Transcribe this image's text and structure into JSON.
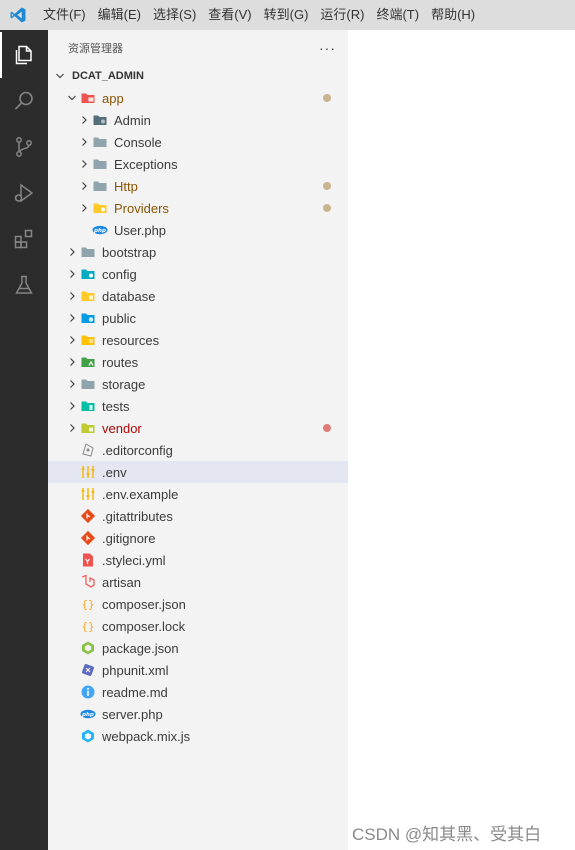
{
  "menu": [
    "文件(F)",
    "编辑(E)",
    "选择(S)",
    "查看(V)",
    "转到(G)",
    "运行(R)",
    "终端(T)",
    "帮助(H)"
  ],
  "activity": [
    "explorer-icon",
    "search-icon",
    "source-control-icon",
    "run-debug-icon",
    "extensions-icon",
    "testing-icon"
  ],
  "explorer": {
    "title": "资源管理器",
    "more": "···",
    "root": "DCAT_ADMIN",
    "items": [
      {
        "label": "app",
        "depth": 1,
        "expanded": true,
        "icon": "folder-app-icon",
        "status": "modified"
      },
      {
        "label": "Admin",
        "depth": 2,
        "expanded": false,
        "icon": "folder-admin-icon"
      },
      {
        "label": "Console",
        "depth": 2,
        "expanded": false,
        "icon": "folder-icon"
      },
      {
        "label": "Exceptions",
        "depth": 2,
        "expanded": false,
        "icon": "folder-icon"
      },
      {
        "label": "Http",
        "depth": 2,
        "expanded": false,
        "icon": "folder-icon",
        "status": "modified"
      },
      {
        "label": "Providers",
        "depth": 2,
        "expanded": false,
        "icon": "folder-providers-icon",
        "status": "modified"
      },
      {
        "label": "User.php",
        "depth": 2,
        "icon": "php-icon"
      },
      {
        "label": "bootstrap",
        "depth": 1,
        "expanded": false,
        "icon": "folder-icon"
      },
      {
        "label": "config",
        "depth": 1,
        "expanded": false,
        "icon": "folder-config-icon"
      },
      {
        "label": "database",
        "depth": 1,
        "expanded": false,
        "icon": "folder-database-icon"
      },
      {
        "label": "public",
        "depth": 1,
        "expanded": false,
        "icon": "folder-public-icon"
      },
      {
        "label": "resources",
        "depth": 1,
        "expanded": false,
        "icon": "folder-resources-icon"
      },
      {
        "label": "routes",
        "depth": 1,
        "expanded": false,
        "icon": "folder-routes-icon"
      },
      {
        "label": "storage",
        "depth": 1,
        "expanded": false,
        "icon": "folder-icon"
      },
      {
        "label": "tests",
        "depth": 1,
        "expanded": false,
        "icon": "folder-tests-icon"
      },
      {
        "label": "vendor",
        "depth": 1,
        "expanded": false,
        "icon": "folder-vendor-icon",
        "status": "error"
      },
      {
        "label": ".editorconfig",
        "depth": 1,
        "icon": "editorconfig-icon"
      },
      {
        "label": ".env",
        "depth": 1,
        "icon": "env-icon",
        "selected": true
      },
      {
        "label": ".env.example",
        "depth": 1,
        "icon": "env-icon"
      },
      {
        "label": ".gitattributes",
        "depth": 1,
        "icon": "git-icon"
      },
      {
        "label": ".gitignore",
        "depth": 1,
        "icon": "git-icon"
      },
      {
        "label": ".styleci.yml",
        "depth": 1,
        "icon": "yaml-icon"
      },
      {
        "label": "artisan",
        "depth": 1,
        "icon": "laravel-icon"
      },
      {
        "label": "composer.json",
        "depth": 1,
        "icon": "json-icon"
      },
      {
        "label": "composer.lock",
        "depth": 1,
        "icon": "json-icon"
      },
      {
        "label": "package.json",
        "depth": 1,
        "icon": "nodejs-icon"
      },
      {
        "label": "phpunit.xml",
        "depth": 1,
        "icon": "phpunit-icon"
      },
      {
        "label": "readme.md",
        "depth": 1,
        "icon": "info-icon"
      },
      {
        "label": "server.php",
        "depth": 1,
        "icon": "php-icon"
      },
      {
        "label": "webpack.mix.js",
        "depth": 1,
        "icon": "webpack-icon"
      }
    ]
  },
  "colors": {
    "modified_dot": "#c9b48f",
    "error_dot": "#e07b7b",
    "modified_text": "#895503",
    "error_text": "#ad0707",
    "accent": "#0065a9"
  },
  "watermark": "CSDN @知其黑、受其白"
}
